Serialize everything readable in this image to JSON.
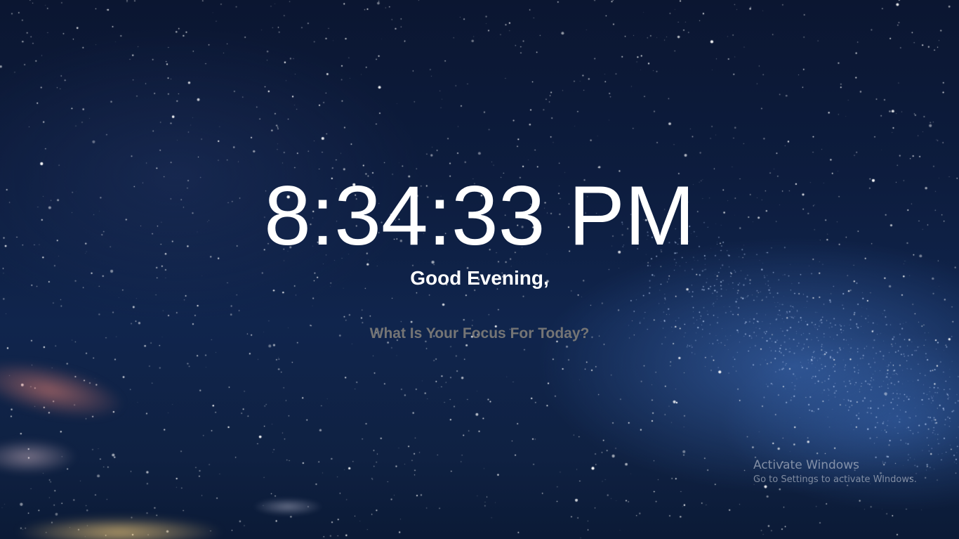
{
  "clock": {
    "time": "8:34:33 PM"
  },
  "greeting": {
    "text": "Good Evening,"
  },
  "focus": {
    "placeholder": "What Is Your Focus For Today?",
    "value": ""
  },
  "watermark": {
    "title": "Activate Windows",
    "subtitle": "Go to Settings to activate Windows."
  },
  "colors": {
    "background": "#0d1d3f",
    "text": "#ffffff",
    "placeholder": "#a6adbb"
  }
}
